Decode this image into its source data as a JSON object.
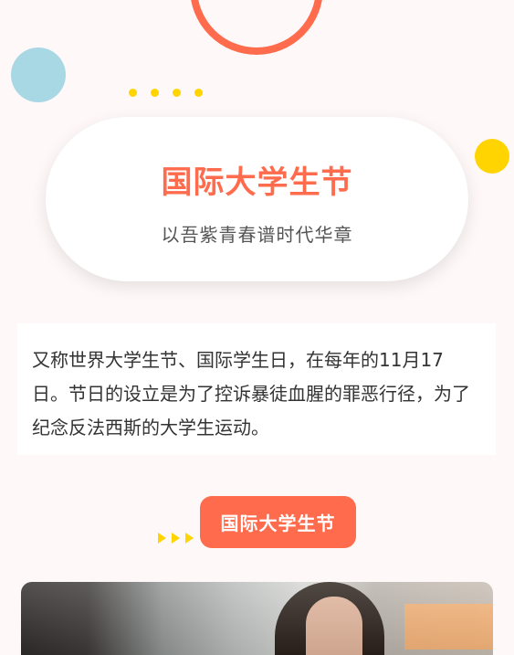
{
  "hero": {
    "title": "国际大学生节",
    "subtitle": "以吾紫青春谱时代华章"
  },
  "description": {
    "text": "又称世界大学生节、国际学生日，在每年的11月17日。节日的设立是为了控诉暴徒血腥的罪恶行径，为了纪念反法西斯的大学生运动。"
  },
  "section_tag": {
    "label": "国际大学生节"
  },
  "colors": {
    "accent": "#ff6b4d",
    "yellow": "#ffd400",
    "blue": "#a9d8e5",
    "background": "#fef8f8"
  }
}
